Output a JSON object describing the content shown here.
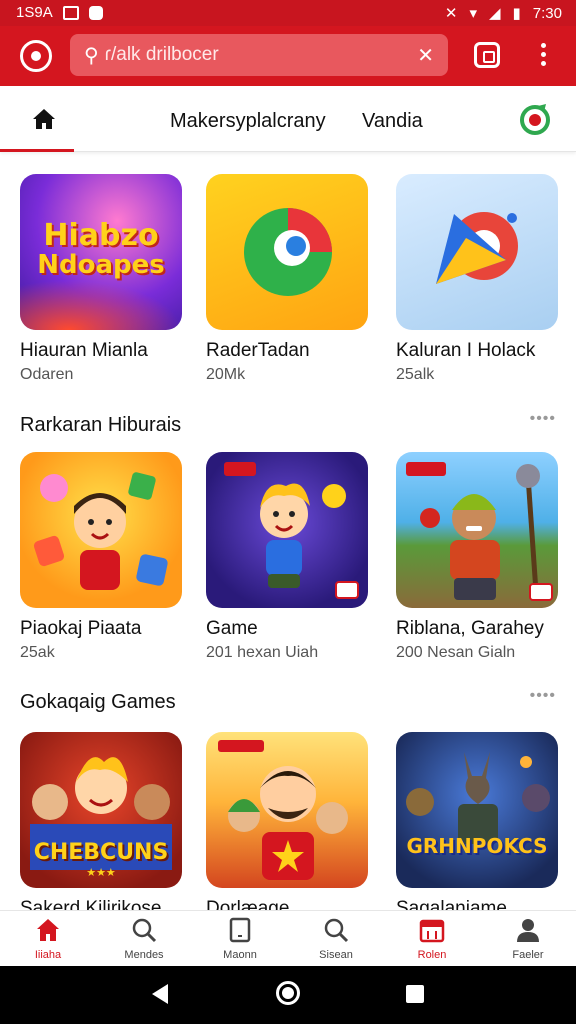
{
  "status_bar": {
    "time_left": "1S9A",
    "time_right": "7:30"
  },
  "search": {
    "query": "ɾ/alk drilbocer"
  },
  "tabs": {
    "active": "home",
    "tab1": "Makersyplalcrany",
    "tab2": "Vandia"
  },
  "featured": [
    {
      "title": "Hiauran Mianla",
      "subtitle": "Odaren",
      "tile_text_1": "Hiabzo",
      "tile_text_2": "Ndoapes"
    },
    {
      "title": "RaderTadan",
      "subtitle": "20Mk"
    },
    {
      "title": "Kaluran I Holack",
      "subtitle": "25alk"
    }
  ],
  "section_2": {
    "title": "Rarkaran Hiburais",
    "more": "••••",
    "cards": [
      {
        "title": "Piaokaj Piaata",
        "subtitle": "25ak"
      },
      {
        "title": "Game",
        "subtitle": "201 hexan Uiah"
      },
      {
        "title": "Riblana, Garahey",
        "subtitle": "200 Nesan Gialn"
      }
    ]
  },
  "section_3": {
    "title": "Gokaqaig Games",
    "more": "••••",
    "cards": [
      {
        "title": "Sakerd Kilirikose",
        "tile_text": "CHEBCUNS",
        "tile_stars": "★★★"
      },
      {
        "title": "Dorlæage"
      },
      {
        "title": "Sagalaniame",
        "tile_text": "GRHNPOKCS"
      }
    ]
  },
  "bottom_nav": [
    {
      "label": "Iiiaha",
      "icon": "home-icon"
    },
    {
      "label": "Mendes",
      "icon": "search-icon"
    },
    {
      "label": "Maonn",
      "icon": "tablet-icon"
    },
    {
      "label": "Sisean",
      "icon": "search-icon"
    },
    {
      "label": "Rolen",
      "icon": "calendar-icon"
    },
    {
      "label": "Faeler",
      "icon": "person-icon"
    }
  ],
  "colors": {
    "brand": "#d4161f",
    "text": "#111111"
  }
}
